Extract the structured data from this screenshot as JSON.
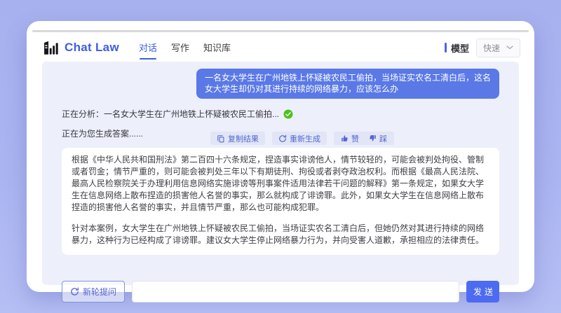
{
  "brand": {
    "name": "Chat Law"
  },
  "header": {
    "tabs": [
      {
        "label": "对话"
      },
      {
        "label": "写作"
      },
      {
        "label": "知识库"
      }
    ],
    "model_label": "模型",
    "model_value": "快速"
  },
  "chat": {
    "user_message": "一名女大学生在广州地铁上怀疑被农民工偷拍，当场证实农名工清白后，这名女大学生却仍对其进行持续的网络暴力，应该怎么办",
    "status_analyzing": "正在分析：一名女大学生在广州地铁上怀疑被农民工偷拍...",
    "status_generating": "正在为您生成答案......",
    "actions": {
      "copy": "复制结果",
      "regenerate": "重新生成",
      "like": "赞",
      "dislike": "踩"
    },
    "answer": [
      "根据《中华人民共和国刑法》第二百四十六条规定，捏造事实诽谤他人，情节较轻的，可能会被判处拘役、管制或者罚金；情节严重的，则可能会被判处三年以下有期徒刑、拘役或者剥夺政治权利。而根据《最高人民法院、最高人民检察院关于办理利用信息网络实施诽谤等刑事案件适用法律若干问题的解释》第一条规定，如果女大学生在信息网络上散布捏造的损害他人名誉的事实，那么就构成了诽谤罪。此外，如果女大学生在信息网络上散布捏造的损害他人名誉的事实，并且情节严重，那么也可能构成犯罪。",
      "针对本案例，女大学生在广州地铁上怀疑被农民工偷拍，当场证实农名工清白后，但她仍然对其进行持续的网络暴力，这种行为已经构成了诽谤罪。建议女大学生停止网络暴力行为，并向受害人道歉，承担相应的法律责任。"
    ]
  },
  "composer": {
    "new_round": "新轮提问",
    "input_value": "",
    "input_placeholder": "",
    "send": "发送"
  },
  "colors": {
    "accent_blue": "#3d5ee0",
    "bubble_blue": "#5a79e6",
    "send_blue": "#4d6bf1",
    "pill_text": "#5566d2",
    "success_green": "#4cc218",
    "chat_bg": "#edeffa",
    "page_bg": "#aab4f0"
  }
}
